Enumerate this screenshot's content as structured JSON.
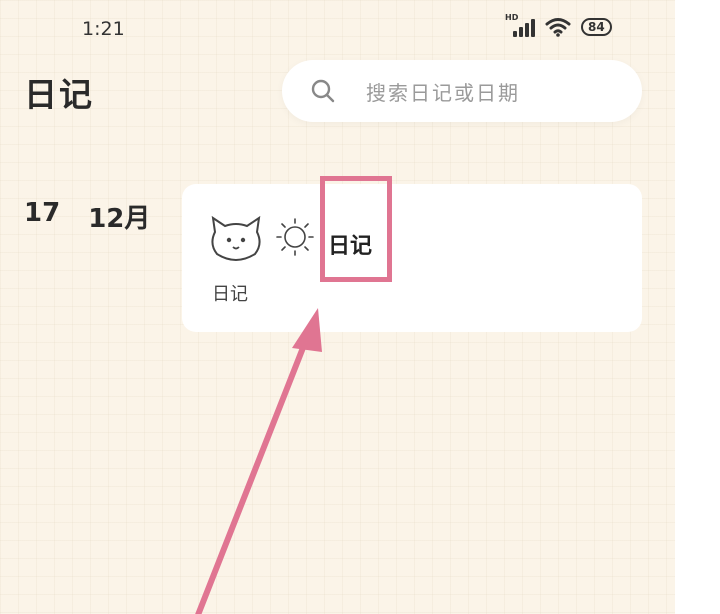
{
  "status_bar": {
    "time": "1:21",
    "network": "HD",
    "battery": "84"
  },
  "header": {
    "title": "日记",
    "search_placeholder": "搜索日记或日期"
  },
  "entries": [
    {
      "day": "17",
      "month": "12月",
      "mood_label": "日记",
      "mood_icon": "cat-face-icon",
      "weather_icon": "sun-icon",
      "title": "日记"
    }
  ],
  "colors": {
    "background": "#fbf4e8",
    "card": "#ffffff",
    "highlight": "#e07592"
  }
}
